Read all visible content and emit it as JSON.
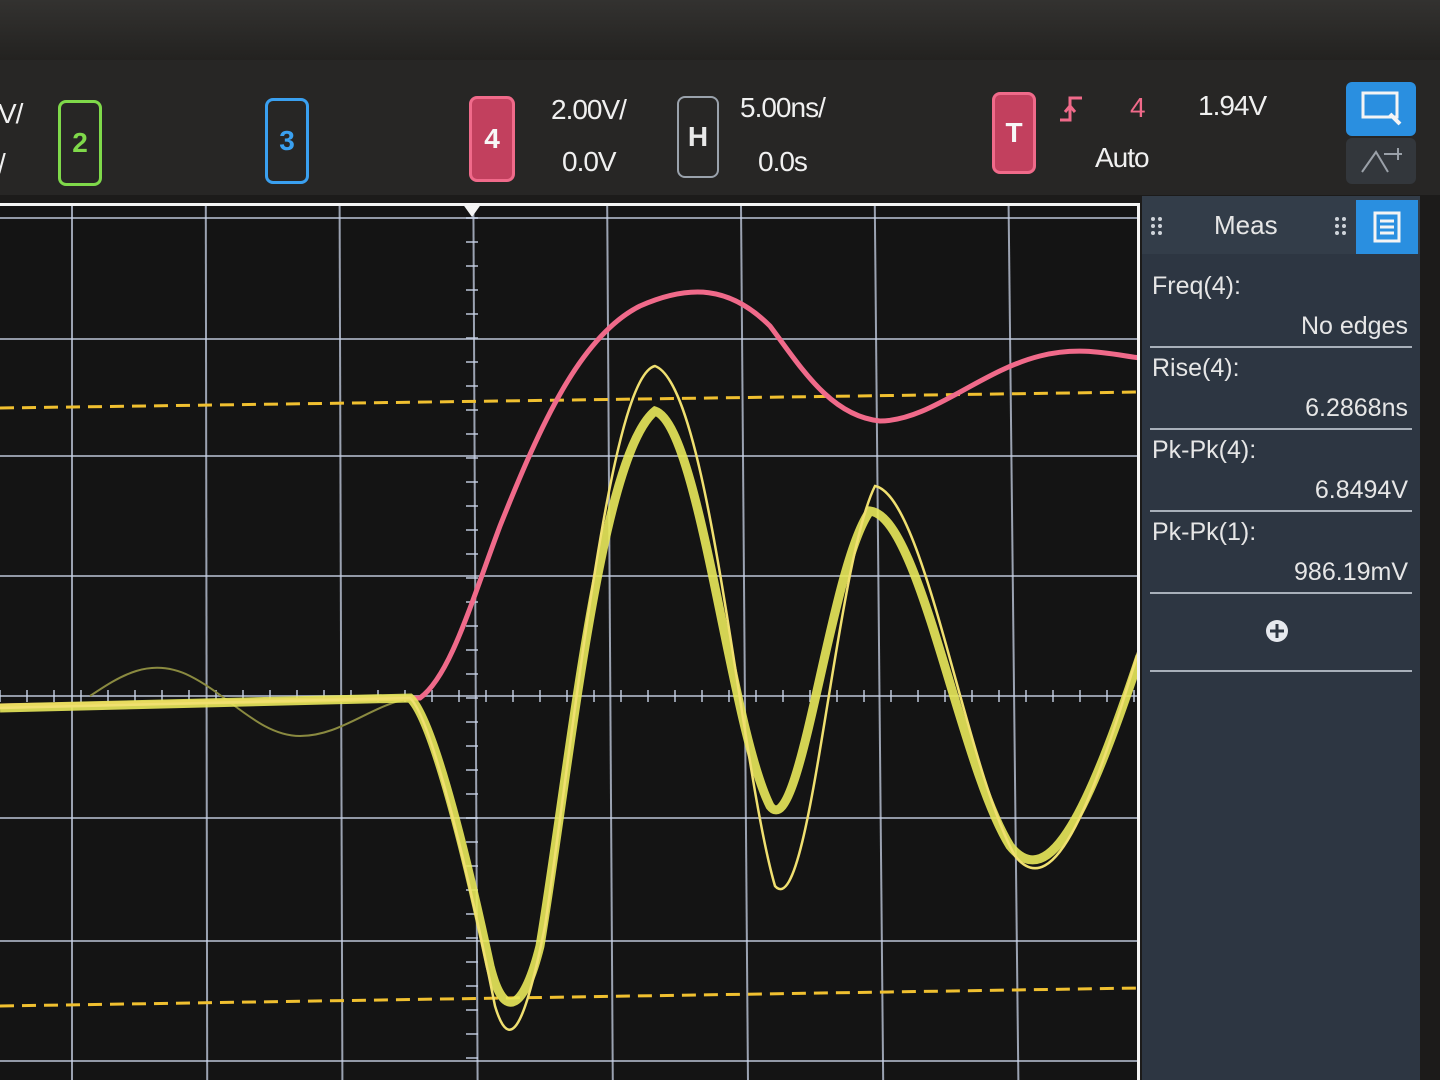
{
  "channels": {
    "ch1_partial": {
      "scale": "V/",
      "offset": "/"
    },
    "ch2": {
      "label": "2"
    },
    "ch3": {
      "label": "3"
    },
    "ch4": {
      "label": "4",
      "scale": "2.00V/",
      "offset": "0.0V"
    }
  },
  "horizontal": {
    "label": "H",
    "scale": "5.00ns/",
    "position": "0.0s"
  },
  "trigger": {
    "label": "T",
    "source": "4",
    "mode": "Auto",
    "level": "1.94V"
  },
  "measurements": {
    "title": "Meas",
    "items": [
      {
        "name": "Freq(4):",
        "value": "No edges"
      },
      {
        "name": "Rise(4):",
        "value": "6.2868ns"
      },
      {
        "name": "Pk-Pk(4):",
        "value": "6.8494V"
      },
      {
        "name": "Pk-Pk(1):",
        "value": "986.19mV"
      }
    ]
  },
  "colors": {
    "ch1": "#e8e85a",
    "ch2": "#7fd94a",
    "ch3": "#3aa0f0",
    "ch4": "#f06a8a",
    "grid": "#c8d2e6",
    "cursor": "#f0c030",
    "accent": "#2a8fe0"
  },
  "icons": [
    "drag-handle-icon",
    "measurement-list-icon",
    "touch-screen-icon",
    "zoom-cursor-icon",
    "rising-edge-icon",
    "add-measurement-icon"
  ]
}
